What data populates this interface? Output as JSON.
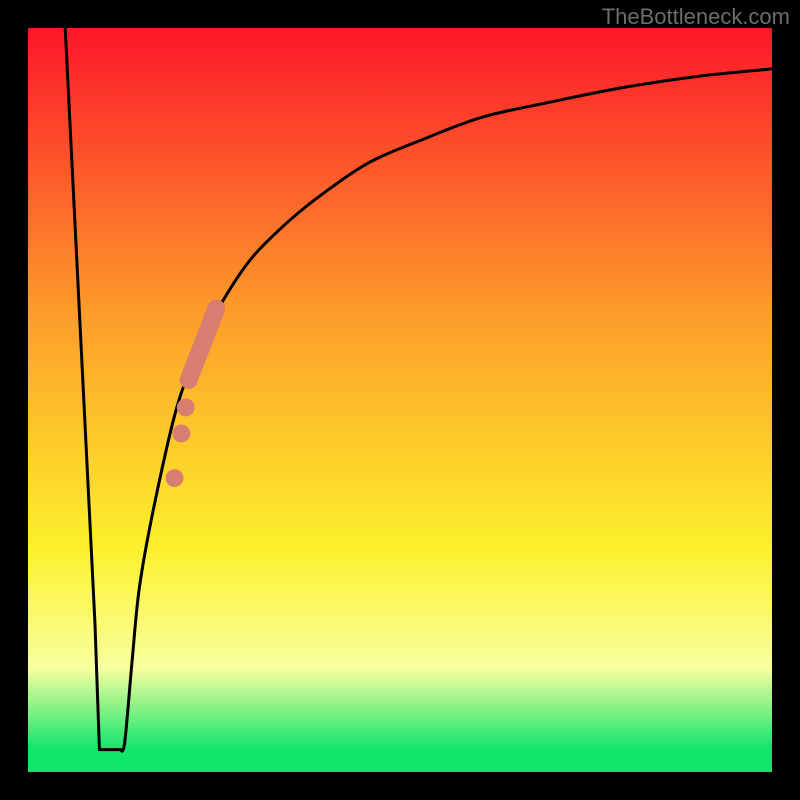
{
  "watermark_text": "TheBottleneck.com",
  "colors": {
    "frame": "#000000",
    "curve": "#000000",
    "marker_fill": "#d77e71",
    "capsule_fill": "#d77e71",
    "gradient_top": "#fd162a",
    "gradient_orange": "#fd9b2a",
    "gradient_yellow": "#fdf12b",
    "gradient_pale": "#f8ff9f",
    "gradient_green": "#10e56c"
  },
  "chart_data": {
    "type": "line",
    "title": "",
    "xlabel": "",
    "ylabel": "",
    "xlim": [
      0,
      100
    ],
    "ylim": [
      0,
      100
    ],
    "curve": {
      "x": [
        5,
        6,
        7,
        8,
        9,
        10,
        11,
        12,
        13,
        14,
        15,
        17,
        20,
        23,
        26,
        30,
        35,
        40,
        46,
        53,
        61,
        70,
        80,
        90,
        100
      ],
      "y": [
        100,
        80,
        60,
        40,
        20,
        4,
        3,
        3,
        4,
        15,
        25,
        36,
        49,
        57,
        63,
        69,
        74,
        78,
        82,
        85,
        88,
        90,
        92,
        93.5,
        94.5
      ]
    },
    "valley_plateau": {
      "x_start": 9.6,
      "x_end": 12.4,
      "y": 3
    },
    "capsule_segment": {
      "x1": 21.6,
      "y1": 52.7,
      "x2": 25.3,
      "y2": 62.3,
      "thickness_pct": 2.4
    },
    "markers": [
      {
        "x": 19.7,
        "y": 39.5,
        "r_pct": 1.2
      },
      {
        "x": 20.6,
        "y": 45.5,
        "r_pct": 1.2
      },
      {
        "x": 21.2,
        "y": 49.0,
        "r_pct": 1.2
      }
    ],
    "annotations": []
  }
}
